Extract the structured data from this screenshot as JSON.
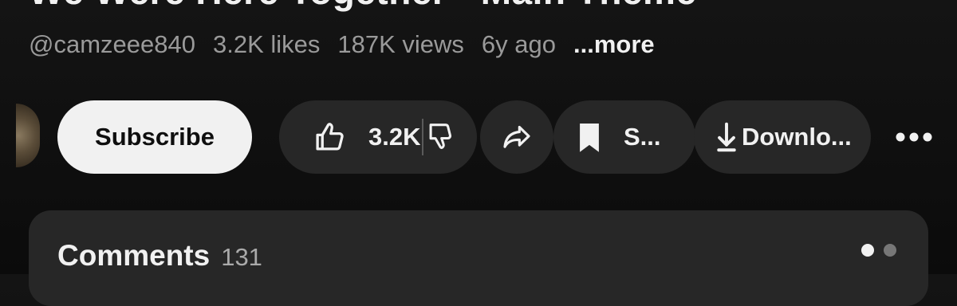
{
  "video": {
    "title": "We Were Here Together - Main Theme"
  },
  "meta": {
    "channel": "@camzeee840",
    "likes": "3.2K likes",
    "views": "187K views",
    "age": "6y ago",
    "more_label": "...more"
  },
  "actions": {
    "subscribe_label": "Subscribe",
    "like_count": "3.2K",
    "save_label": "S...",
    "download_label": "Downlo..."
  },
  "comments": {
    "title": "Comments",
    "count": "131"
  },
  "colors": {
    "background": "#0f0f0f",
    "pill_background": "#272727",
    "primary_text": "#f1f1f1",
    "secondary_text": "#9a9a9a",
    "subscribe_background": "#f1f1f1",
    "subscribe_text": "#0f0f0f"
  },
  "icons": {
    "like": "thumb-up-icon",
    "dislike": "thumb-down-icon",
    "share": "share-arrow-icon",
    "save": "bookmark-icon",
    "download": "download-arrow-icon",
    "more": "more-horizontal-icon"
  }
}
